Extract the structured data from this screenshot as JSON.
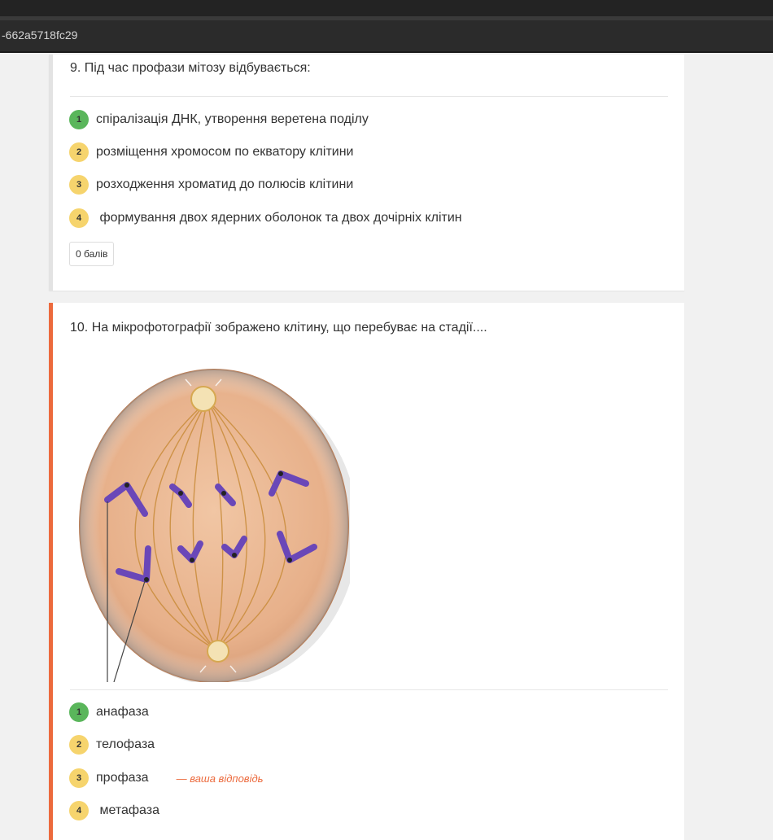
{
  "browser": {
    "url_fragment": "-662a5718fc29"
  },
  "questions": [
    {
      "text": "9. Під час профази мітозу відбувається:",
      "options": [
        {
          "num": "1",
          "label": "спіралізація ДНК, утворення веретена поділу",
          "correct": true
        },
        {
          "num": "2",
          "label": "розміщення хромосом по екватору клітини",
          "correct": false
        },
        {
          "num": "3",
          "label": "розходження хроматид до полюсів клітини",
          "correct": false
        },
        {
          "num": "4",
          "label": " формування двох ядерних оболонок та двох дочірніх клітин",
          "correct": false
        }
      ],
      "score": "0 балів"
    },
    {
      "text": "10. На мікрофотографії зображено клітину, що перебуває на стадії....",
      "image_icon": "cell-metaphase-illustration",
      "options": [
        {
          "num": "1",
          "label": "анафаза",
          "correct": true
        },
        {
          "num": "2",
          "label": "телофаза",
          "correct": false
        },
        {
          "num": "3",
          "label": "профаза",
          "correct": false,
          "note": "— ваша відповідь"
        },
        {
          "num": "4",
          "label": " метафаза",
          "correct": false
        }
      ]
    }
  ],
  "colors": {
    "correct": "#5ab65b",
    "option": "#f6d46d",
    "wrong_accent": "#ec6a3d"
  }
}
